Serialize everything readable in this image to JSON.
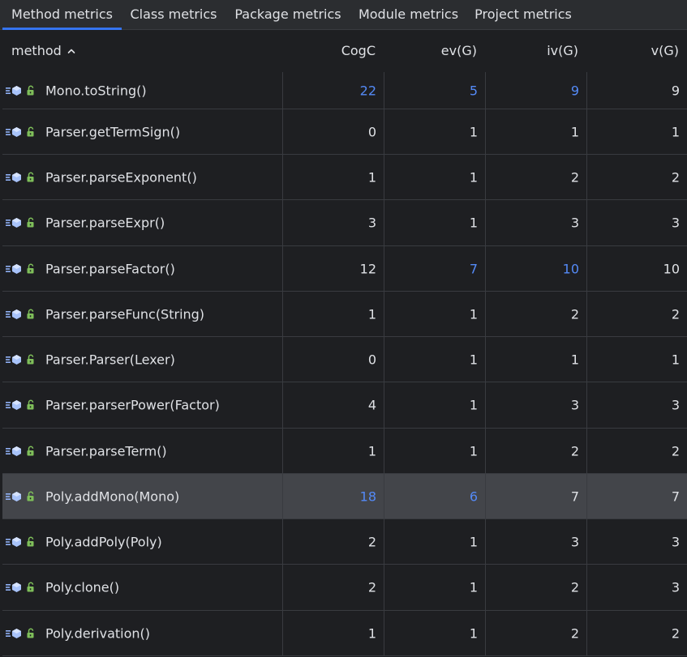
{
  "tabs": [
    {
      "label": "Method metrics",
      "active": true
    },
    {
      "label": "Class metrics",
      "active": false
    },
    {
      "label": "Package metrics",
      "active": false
    },
    {
      "label": "Module metrics",
      "active": false
    },
    {
      "label": "Project metrics",
      "active": false
    }
  ],
  "table": {
    "columns": [
      "method",
      "CogC",
      "ev(G)",
      "iv(G)",
      "v(G)"
    ],
    "sort_icon": "chevron-up-icon",
    "row_icons": [
      "method-icon",
      "public-lock-icon"
    ],
    "rows": [
      {
        "method": "Mono.toString()",
        "CogC": "22",
        "evG": "5",
        "ivG": "9",
        "vG": "9",
        "hl": [
          "CogC",
          "evG",
          "ivG"
        ],
        "selected": false
      },
      {
        "method": "Parser.getTermSign()",
        "CogC": "0",
        "evG": "1",
        "ivG": "1",
        "vG": "1",
        "hl": [],
        "selected": false
      },
      {
        "method": "Parser.parseExponent()",
        "CogC": "1",
        "evG": "1",
        "ivG": "2",
        "vG": "2",
        "hl": [],
        "selected": false
      },
      {
        "method": "Parser.parseExpr()",
        "CogC": "3",
        "evG": "1",
        "ivG": "3",
        "vG": "3",
        "hl": [],
        "selected": false
      },
      {
        "method": "Parser.parseFactor()",
        "CogC": "12",
        "evG": "7",
        "ivG": "10",
        "vG": "10",
        "hl": [
          "evG",
          "ivG"
        ],
        "selected": false
      },
      {
        "method": "Parser.parseFunc(String)",
        "CogC": "1",
        "evG": "1",
        "ivG": "2",
        "vG": "2",
        "hl": [],
        "selected": false
      },
      {
        "method": "Parser.Parser(Lexer)",
        "CogC": "0",
        "evG": "1",
        "ivG": "1",
        "vG": "1",
        "hl": [],
        "selected": false
      },
      {
        "method": "Parser.parserPower(Factor)",
        "CogC": "4",
        "evG": "1",
        "ivG": "3",
        "vG": "3",
        "hl": [],
        "selected": false
      },
      {
        "method": "Parser.parseTerm()",
        "CogC": "1",
        "evG": "1",
        "ivG": "2",
        "vG": "2",
        "hl": [],
        "selected": false
      },
      {
        "method": "Poly.addMono(Mono)",
        "CogC": "18",
        "evG": "6",
        "ivG": "7",
        "vG": "7",
        "hl": [
          "CogC",
          "evG"
        ],
        "selected": true
      },
      {
        "method": "Poly.addPoly(Poly)",
        "CogC": "2",
        "evG": "1",
        "ivG": "3",
        "vG": "3",
        "hl": [],
        "selected": false
      },
      {
        "method": "Poly.clone()",
        "CogC": "2",
        "evG": "1",
        "ivG": "2",
        "vG": "3",
        "hl": [],
        "selected": false
      },
      {
        "method": "Poly.derivation()",
        "CogC": "1",
        "evG": "1",
        "ivG": "2",
        "vG": "2",
        "hl": [],
        "selected": false
      }
    ]
  },
  "colors": {
    "highlight": "#548af7",
    "accent": "#3574f0",
    "selected_row": "#43454a"
  }
}
